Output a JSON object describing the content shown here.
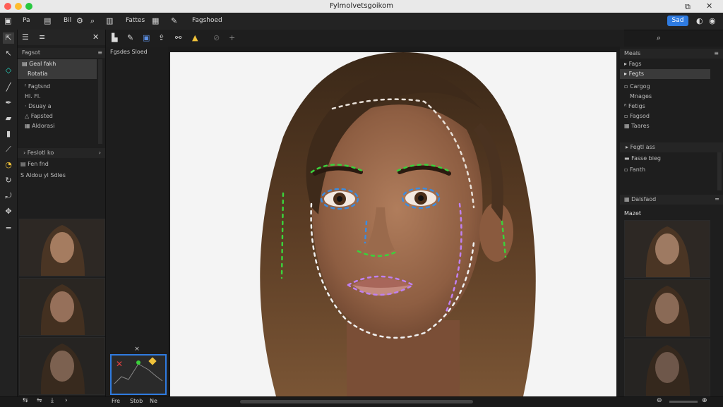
{
  "window": {
    "title": "Fylmolvetsgoikom"
  },
  "toolbar": {
    "menu1": "Pa",
    "menu2": "Bil",
    "menu3": "Fattes",
    "menu4": "Fagshoed",
    "share_label": "Sad"
  },
  "left_panel": {
    "header": "Fagsot",
    "items": [
      {
        "label": "Geal fakh"
      },
      {
        "label": "Rotatia"
      },
      {
        "label": "Fagtsnd"
      },
      {
        "label": "Hl. Fl."
      },
      {
        "label": "Dsuay a"
      },
      {
        "label": "Fapsted"
      },
      {
        "label": "Aldorasi"
      }
    ],
    "group_label": "Feslotl ko",
    "sub1": "Fen fnd",
    "sub2": "S Aldou yl Sdles"
  },
  "second_toolbar": {
    "label": "Fgsdes Sloed"
  },
  "minimap": {
    "close": "×"
  },
  "right_panel": {
    "header": "Meals",
    "items": [
      {
        "label": "Fags"
      },
      {
        "label": "Fegts"
      },
      {
        "label": "Cargog"
      },
      {
        "label": "Mnages"
      },
      {
        "label": "Fetigs"
      },
      {
        "label": "Fagsod"
      },
      {
        "label": "Taares"
      }
    ],
    "group_label": "Fegtl ass",
    "sub1": "Fasse bieg",
    "sub2": "Fanth",
    "section2": "Dalsfaod",
    "history": "Mazet"
  },
  "status": {
    "tab1": "Fre",
    "tab2": "Stob",
    "tab3": "Ne"
  }
}
